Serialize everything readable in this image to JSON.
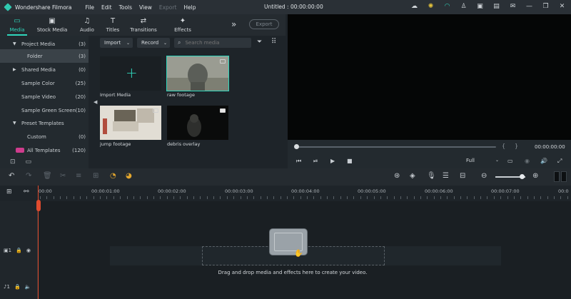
{
  "app": {
    "name": "Wondershare Filmora",
    "menus": [
      "File",
      "Edit",
      "Tools",
      "View",
      "Export",
      "Help"
    ],
    "disabled_menus": [
      "Export"
    ],
    "doc_title": "Untitled : 00:00:00:00"
  },
  "title_icons": [
    "cloud-icon",
    "bulb-icon",
    "headset-icon",
    "user-icon",
    "save-icon",
    "cart-icon",
    "mail-icon",
    "minimize-icon",
    "restore-icon",
    "close-icon"
  ],
  "tabs": [
    {
      "label": "Media",
      "icon": "folder-icon",
      "active": true
    },
    {
      "label": "Stock Media",
      "icon": "stock-icon"
    },
    {
      "label": "Audio",
      "icon": "music-icon"
    },
    {
      "label": "Titles",
      "icon": "text-icon"
    },
    {
      "label": "Transitions",
      "icon": "transitions-icon"
    },
    {
      "label": "Effects",
      "icon": "effects-icon"
    }
  ],
  "export_label": "Export",
  "sidebar": [
    {
      "label": "Project Media",
      "count": "(3)",
      "arrow": "▼",
      "indent": 1
    },
    {
      "label": "Folder",
      "count": "(3)",
      "indent": 3,
      "selected": true
    },
    {
      "label": "Shared Media",
      "count": "(0)",
      "arrow": "▶",
      "indent": 1
    },
    {
      "label": "Sample Color",
      "count": "(25)",
      "indent": 2
    },
    {
      "label": "Sample Video",
      "count": "(20)",
      "indent": 2
    },
    {
      "label": "Sample Green Screen",
      "count": "(10)",
      "indent": 2
    },
    {
      "label": "Preset Templates",
      "count": "",
      "arrow": "▼",
      "indent": 1
    },
    {
      "label": "Custom",
      "count": "(0)",
      "indent": 3
    },
    {
      "label": "All Templates",
      "count": "(120)",
      "indent": 2,
      "badge": "NEW"
    }
  ],
  "media_toolbar": {
    "import_label": "Import",
    "record_label": "Record",
    "search_placeholder": "Search media"
  },
  "media_items": [
    {
      "caption": "Import Media",
      "kind": "import"
    },
    {
      "caption": "raw footage",
      "kind": "video",
      "selected": true
    },
    {
      "caption": "jump footage",
      "kind": "video"
    },
    {
      "caption": "debris overlay",
      "kind": "video"
    }
  ],
  "preview": {
    "timecode": "00:00:00:00",
    "quality": "Full",
    "progress": 0
  },
  "timeline": {
    "ruler": [
      "00:00",
      "00:00:01:00",
      "00:00:02:00",
      "00:00:03:00",
      "00:00:04:00",
      "00:00:05:00",
      "00:00:06:00",
      "00:00:07:00",
      "00:0"
    ],
    "tracks": [
      {
        "label": "1",
        "kind": "video"
      },
      {
        "label": "1",
        "kind": "audio"
      }
    ],
    "drop_hint": "Drag and drop media and effects here to create your video.",
    "zoom_level": 0.8
  }
}
